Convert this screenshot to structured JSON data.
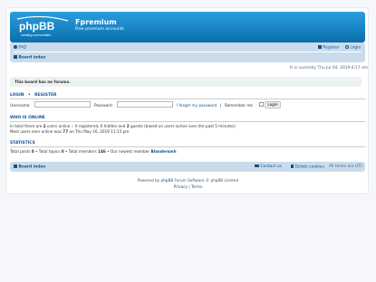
{
  "site": {
    "title": "Fpremium",
    "description": "Free premium accounts",
    "logo_text": "phpBB",
    "logo_subtext": "creating communities"
  },
  "nav": {
    "faq": "FAQ",
    "register": "Register",
    "login": "Login",
    "board_index": "Board index"
  },
  "time_notice": "It is currently Thu Jul 04, 2019 6:17 am",
  "notice": "This board has no forums.",
  "login": {
    "heading_login": "LOGIN",
    "heading_sep": "•",
    "heading_register": "REGISTER",
    "username_label": "Username:",
    "password_label": "Password:",
    "forgot": "I forgot my password",
    "remember": "Remember me",
    "button": "Login"
  },
  "who_online": {
    "heading": "WHO IS ONLINE",
    "line1_a": "In total there are",
    "total": "2",
    "line1_b": "users online :: 0 registered, 0 hidden and",
    "guests": "2",
    "line1_c": "guests (based on users active over the past 5 minutes)",
    "line2_a": "Most users ever online was",
    "most": "77",
    "line2_b": "on Thu May 16, 2019 11:15 pm"
  },
  "stats": {
    "heading": "STATISTICS",
    "posts_label": "Total posts",
    "posts": "0",
    "topics_label": "Total topics",
    "topics": "0",
    "members_label": "Total members",
    "members": "146",
    "newest_label": "Our newest member",
    "newest": "Blandersmh"
  },
  "footer_nav": {
    "board_index": "Board index",
    "contact": "Contact us",
    "delete_cookies": "Delete cookies",
    "timezone": "All times are UTC"
  },
  "footer": {
    "powered_a": "Powered by",
    "phpbb": "phpBB",
    "powered_b": "Forum Software © phpBB Limited",
    "privacy": "Privacy",
    "sep": "|",
    "terms": "Terms"
  },
  "colors": {
    "header": "#1b8ac6",
    "navbar": "#cadceb",
    "link": "#105289",
    "heading": "#115098"
  }
}
